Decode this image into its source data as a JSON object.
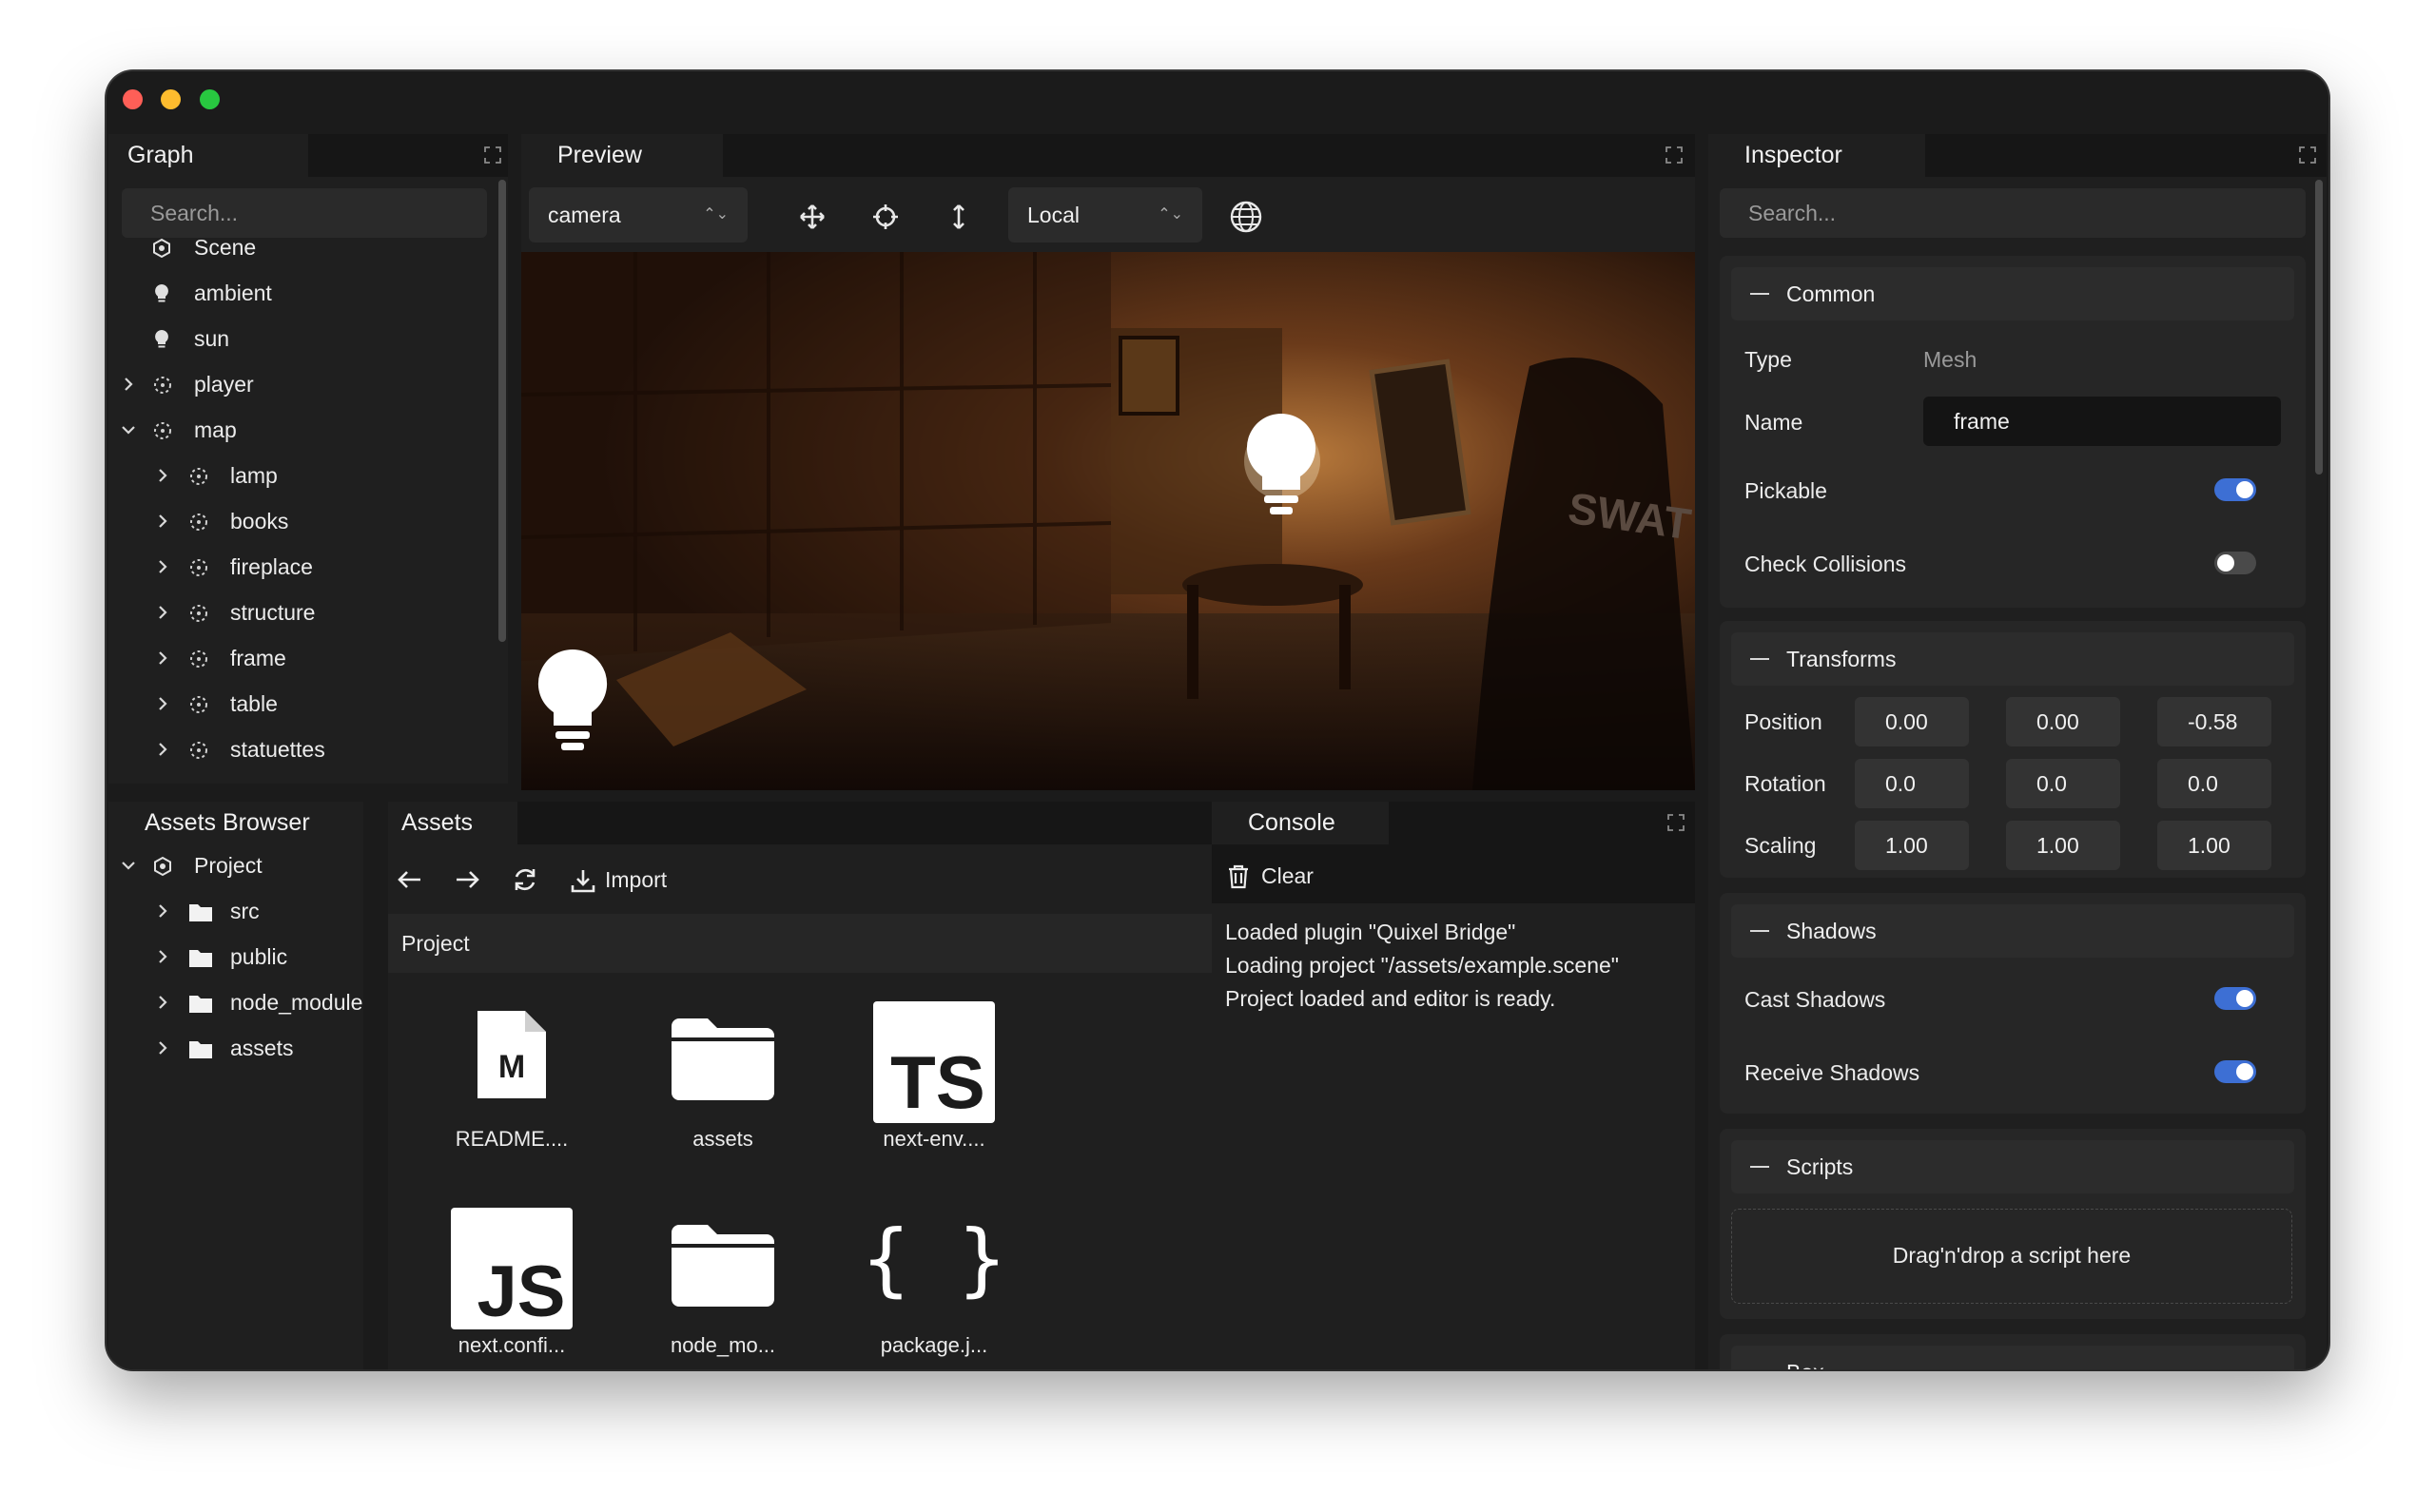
{
  "graph": {
    "title": "Graph",
    "search_placeholder": "Search...",
    "items": [
      {
        "label": "Scene"
      },
      {
        "label": "ambient"
      },
      {
        "label": "sun"
      },
      {
        "label": "player"
      },
      {
        "label": "map"
      },
      {
        "label": "lamp"
      },
      {
        "label": "books"
      },
      {
        "label": "fireplace"
      },
      {
        "label": "structure"
      },
      {
        "label": "frame"
      },
      {
        "label": "table"
      },
      {
        "label": "statuettes"
      }
    ]
  },
  "preview": {
    "title": "Preview",
    "camera_select": "camera",
    "space_select": "Local",
    "viewport_text": "SWAT"
  },
  "inspector": {
    "title": "Inspector",
    "search_placeholder": "Search...",
    "common": {
      "title": "Common",
      "type_label": "Type",
      "type_value": "Mesh",
      "name_label": "Name",
      "name_value": "frame",
      "pickable_label": "Pickable",
      "pickable": true,
      "check_collisions_label": "Check Collisions",
      "check_collisions": false
    },
    "transforms": {
      "title": "Transforms",
      "position_label": "Position",
      "position": [
        "0.00",
        "0.00",
        "-0.58"
      ],
      "rotation_label": "Rotation",
      "rotation": [
        "0.0",
        "0.0",
        "0.0"
      ],
      "scaling_label": "Scaling",
      "scaling": [
        "1.00",
        "1.00",
        "1.00"
      ]
    },
    "shadows": {
      "title": "Shadows",
      "cast_label": "Cast Shadows",
      "cast": true,
      "receive_label": "Receive Shadows",
      "receive": true
    },
    "scripts": {
      "title": "Scripts",
      "drop_hint": "Drag'n'drop a script here"
    },
    "next_section": "Box"
  },
  "assets_browser": {
    "title": "Assets Browser",
    "items": [
      {
        "label": "Project"
      },
      {
        "label": "src"
      },
      {
        "label": "public"
      },
      {
        "label": "node_modules"
      },
      {
        "label": "assets"
      }
    ]
  },
  "assets": {
    "title": "Assets",
    "import_label": "Import",
    "breadcrumb": "Project",
    "files": [
      {
        "label": "README....",
        "icon": "markdown-file-icon",
        "badge": "M"
      },
      {
        "label": "assets",
        "icon": "folder-icon"
      },
      {
        "label": "next-env....",
        "icon": "typescript-file-icon",
        "badge": "TS"
      },
      {
        "label": "next.confi...",
        "icon": "javascript-file-icon",
        "badge": "JS"
      },
      {
        "label": "node_mo...",
        "icon": "folder-icon"
      },
      {
        "label": "package.j...",
        "icon": "json-file-icon",
        "badge": "{ }"
      }
    ]
  },
  "console": {
    "title": "Console",
    "clear_label": "Clear",
    "lines": [
      "Loaded plugin \"Quixel Bridge\"",
      "Loading project \"/assets/example.scene\"",
      "Project loaded and editor is ready."
    ]
  },
  "colors": {
    "window_bg": "#1b1b1b",
    "panel_bg": "#1f1f1f",
    "toggle_on": "#3d6fd4",
    "toggle_off": "#4a4a4a"
  }
}
